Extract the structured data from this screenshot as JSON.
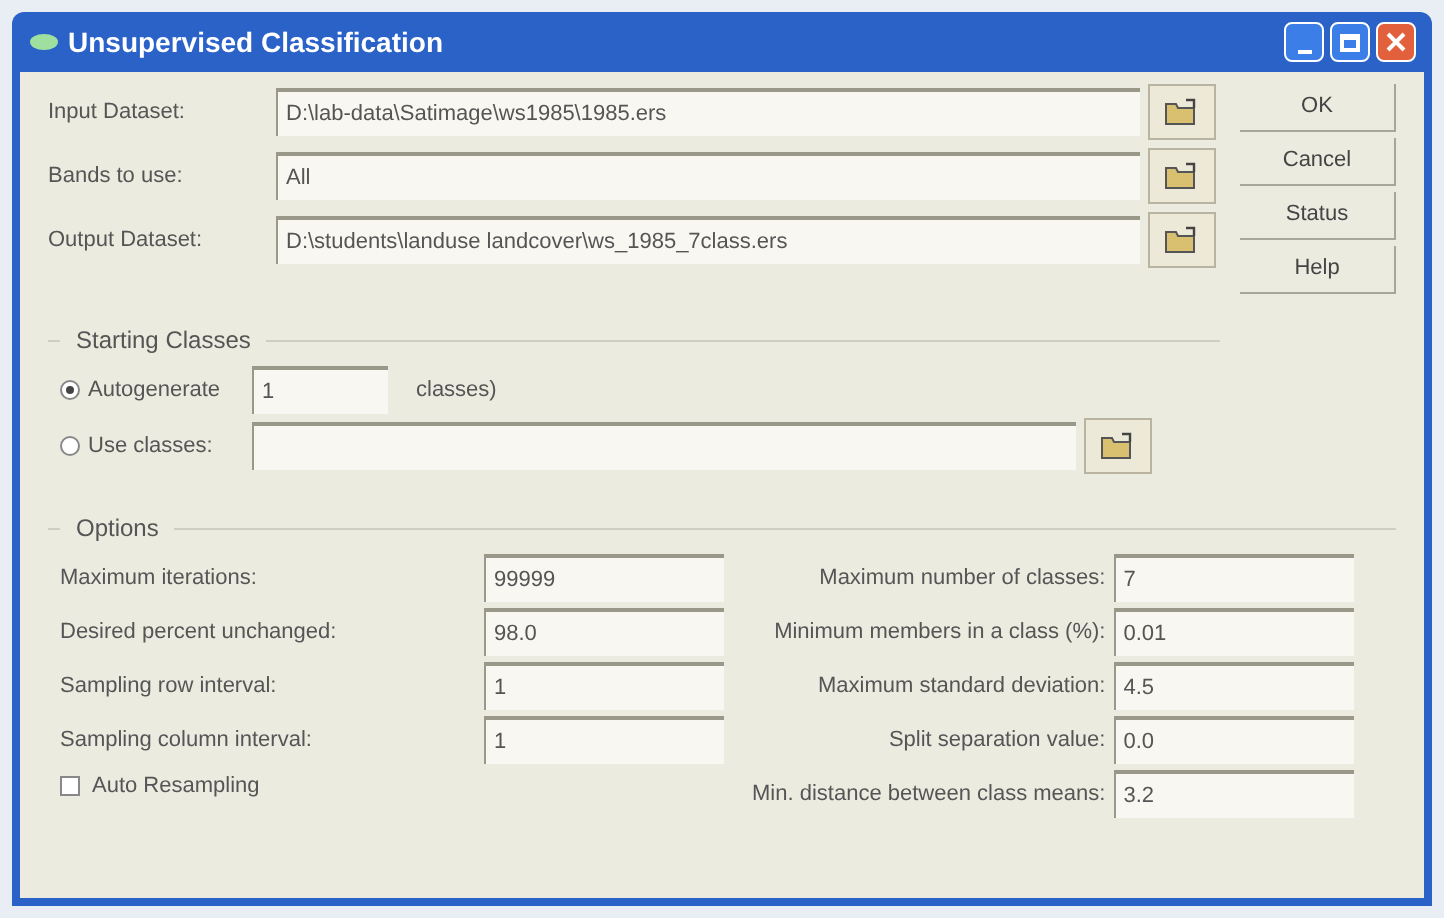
{
  "window": {
    "title": "Unsupervised Classification"
  },
  "files": [
    {
      "label": "Input Dataset:",
      "value": "D:\\lab-data\\Satimage\\ws1985\\1985.ers"
    },
    {
      "label": "Bands to use:",
      "value": "All"
    },
    {
      "label": "Output Dataset:",
      "value": "D:\\students\\landuse landcover\\ws_1985_7class.ers"
    }
  ],
  "buttons": [
    "OK",
    "Cancel",
    "Status",
    "Help"
  ],
  "starting_classes": {
    "title": "Starting Classes",
    "options": [
      {
        "label": "Autogenerate",
        "selected": true,
        "value": "1",
        "suffix": "classes)"
      },
      {
        "label": "Use classes:",
        "selected": false
      }
    ]
  },
  "options": {
    "title": "Options",
    "left": [
      {
        "label": "Maximum iterations:",
        "value": "99999"
      },
      {
        "label": "Desired percent unchanged:",
        "value": "98.0"
      },
      {
        "label": "Sampling row interval:",
        "value": "1"
      },
      {
        "label": "Sampling column interval:",
        "value": "1"
      }
    ],
    "right": [
      {
        "label": "Maximum number of classes:",
        "value": "7"
      },
      {
        "label": "Minimum members in a class (%):",
        "value": "0.01"
      },
      {
        "label": "Maximum standard deviation:",
        "value": "4.5"
      },
      {
        "label": "Split separation value:",
        "value": "0.0"
      },
      {
        "label": "Min. distance between class means:",
        "value": "3.2"
      }
    ],
    "auto_resampling": {
      "label": "Auto Resampling",
      "checked": false
    }
  }
}
